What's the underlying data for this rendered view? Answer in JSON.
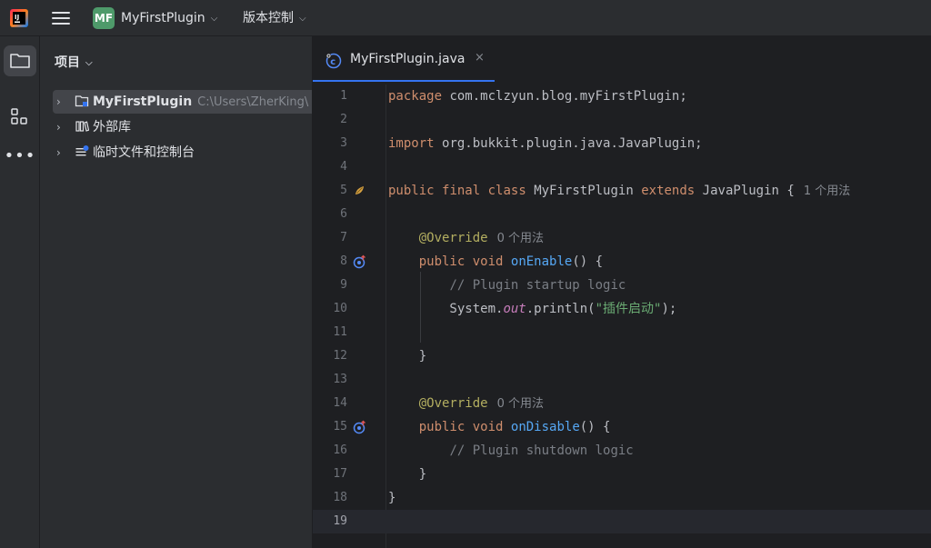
{
  "titlebar": {
    "project_badge": "MF",
    "project_name": "MyFirstPlugin",
    "vcs_label": "版本控制"
  },
  "panel": {
    "title": "项目",
    "tree": [
      {
        "label": "MyFirstPlugin",
        "path": "C:\\Users\\ZherKing\\"
      },
      {
        "label": "外部库"
      },
      {
        "label": "临时文件和控制台"
      }
    ]
  },
  "editor": {
    "tab_label": "MyFirstPlugin.java",
    "tab_close": "×",
    "current_line": 19,
    "lines": [
      {
        "n": "1",
        "tokens": [
          [
            "kw",
            "package"
          ],
          [
            "",
            "com.mclzyun.blog.myFirstPlugin;"
          ]
        ]
      },
      {
        "n": "2",
        "tokens": []
      },
      {
        "n": "3",
        "tokens": [
          [
            "kw",
            "import"
          ],
          [
            "",
            "org.bukkit.plugin.java.JavaPlugin;"
          ]
        ]
      },
      {
        "n": "4",
        "tokens": []
      },
      {
        "n": "5",
        "tokens": [
          [
            "kw",
            "public"
          ],
          [
            "kw",
            "final"
          ],
          [
            "kw",
            "class"
          ],
          [
            "",
            "MyFirstPlugin"
          ],
          [
            "kw",
            "extends"
          ],
          [
            "",
            "JavaPlugin {"
          ]
        ],
        "hint": "1 个用法",
        "mark": "bean-icon"
      },
      {
        "n": "6",
        "tokens": []
      },
      {
        "n": "7",
        "tokens": [
          [
            "",
            "    "
          ],
          [
            "ann",
            "@Override"
          ]
        ],
        "hint": "0 个用法"
      },
      {
        "n": "8",
        "tokens": [
          [
            "",
            "    "
          ],
          [
            "kw",
            "public"
          ],
          [
            "kw",
            "void"
          ],
          [
            "fn",
            "onEnable"
          ],
          [
            "",
            "() {"
          ]
        ],
        "mark": "override-icon"
      },
      {
        "n": "9",
        "tokens": [
          [
            "",
            "        "
          ],
          [
            "cmt",
            "// Plugin startup logic"
          ]
        ]
      },
      {
        "n": "10",
        "tokens": [
          [
            "",
            "        System."
          ],
          [
            "fld",
            "out"
          ],
          [
            "",
            ".println("
          ],
          [
            "str",
            "\"插件启动\""
          ],
          [
            "",
            ");"
          ]
        ]
      },
      {
        "n": "11",
        "tokens": []
      },
      {
        "n": "12",
        "tokens": [
          [
            "",
            "    }"
          ]
        ]
      },
      {
        "n": "13",
        "tokens": []
      },
      {
        "n": "14",
        "tokens": [
          [
            "",
            "    "
          ],
          [
            "ann",
            "@Override"
          ]
        ],
        "hint": "0 个用法"
      },
      {
        "n": "15",
        "tokens": [
          [
            "",
            "    "
          ],
          [
            "kw",
            "public"
          ],
          [
            "kw",
            "void"
          ],
          [
            "fn",
            "onDisable"
          ],
          [
            "",
            "() {"
          ]
        ],
        "mark": "override-icon"
      },
      {
        "n": "16",
        "tokens": [
          [
            "",
            "        "
          ],
          [
            "cmt",
            "// Plugin shutdown logic"
          ]
        ]
      },
      {
        "n": "17",
        "tokens": [
          [
            "",
            "    }"
          ]
        ]
      },
      {
        "n": "18",
        "tokens": [
          [
            "",
            "}"
          ]
        ]
      },
      {
        "n": "19",
        "tokens": []
      }
    ]
  },
  "colors": {
    "keyword": "#cf8e6d",
    "annotation": "#b3ae60",
    "method": "#56a8f5",
    "comment": "#7a7e85",
    "string": "#6aab73",
    "static_field": "#c77dbb",
    "accent": "#3574f0"
  },
  "icons": {
    "app": "intellij-logo-icon",
    "menu": "hamburger-menu-icon",
    "project_tool": "folder-icon",
    "structure_tool": "structure-icon",
    "more_tools": "more-icon",
    "tab": "java-class-icon"
  }
}
